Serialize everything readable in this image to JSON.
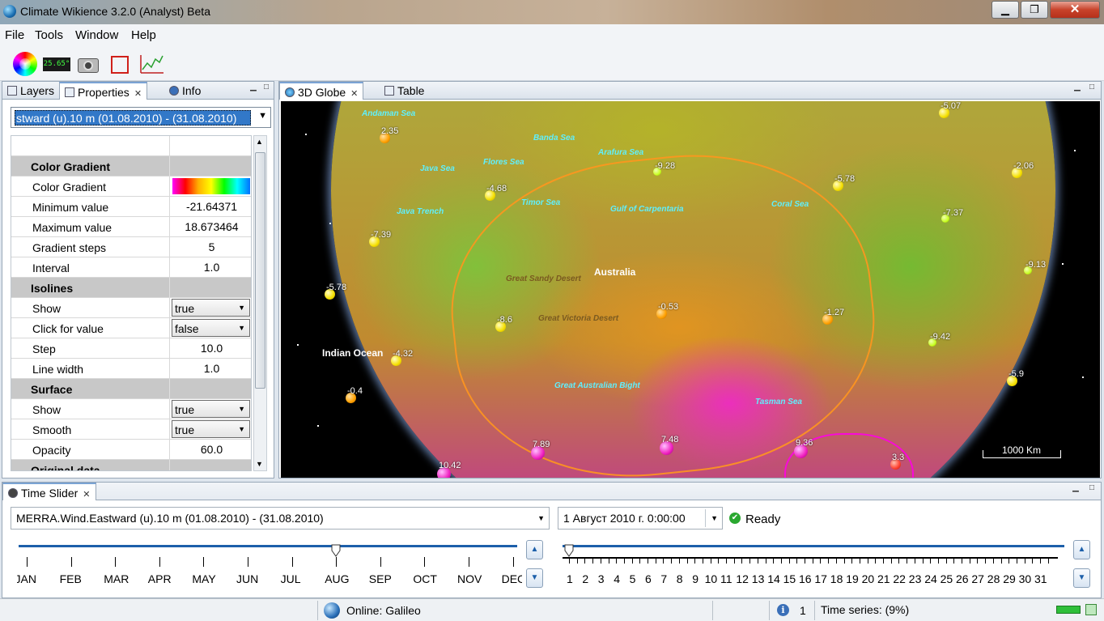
{
  "window": {
    "title": "Climate Wikience 3.2.0 (Analyst) Beta",
    "min": "▁",
    "max": "❐",
    "close": "✕"
  },
  "menu": [
    "File",
    "Tools",
    "Window",
    "Help"
  ],
  "toolbar": {
    "temp_display": "25.65°",
    "icons": [
      "color-palette-icon",
      "temperature-display-icon",
      "camera-icon",
      "region-select-icon",
      "chart-icon"
    ]
  },
  "left_panel": {
    "tabs": [
      {
        "label": "Layers"
      },
      {
        "label": "Properties",
        "close": "✕"
      },
      {
        "label": "Info"
      }
    ],
    "layer_select": "stward (u).10 m  (01.08.2010)  -  (31.08.2010)",
    "properties": [
      {
        "type": "cat",
        "name": "Color Gradient"
      },
      {
        "type": "grad",
        "name": "Color Gradient"
      },
      {
        "type": "val",
        "name": "Minimum value",
        "value": "-21.64371"
      },
      {
        "type": "val",
        "name": "Maximum value",
        "value": "18.673464"
      },
      {
        "type": "val",
        "name": "Gradient steps",
        "value": "5"
      },
      {
        "type": "val",
        "name": "Interval",
        "value": "1.0"
      },
      {
        "type": "cat",
        "name": "Isolines"
      },
      {
        "type": "combo",
        "name": "Show",
        "value": "true"
      },
      {
        "type": "combo",
        "name": "Click for value",
        "value": "false"
      },
      {
        "type": "val",
        "name": "Step",
        "value": "10.0"
      },
      {
        "type": "val",
        "name": "Line width",
        "value": "1.0"
      },
      {
        "type": "cat",
        "name": "Surface"
      },
      {
        "type": "combo",
        "name": "Show",
        "value": "true"
      },
      {
        "type": "combo",
        "name": "Smooth",
        "value": "true"
      },
      {
        "type": "val",
        "name": "Opacity",
        "value": "60.0"
      },
      {
        "type": "cat",
        "name": "Original data"
      }
    ]
  },
  "globe_panel": {
    "tabs": [
      {
        "label": "3D Globe",
        "close": "✕"
      },
      {
        "label": "Table"
      }
    ],
    "places": [
      {
        "name": "Andaman Sea",
        "style": ""
      },
      {
        "name": "Banda Sea",
        "style": ""
      },
      {
        "name": "Arafura Sea",
        "style": ""
      },
      {
        "name": "Java Sea",
        "style": ""
      },
      {
        "name": "Flores Sea",
        "style": ""
      },
      {
        "name": "Timor Sea",
        "style": ""
      },
      {
        "name": "Gulf of Carpentaria",
        "style": ""
      },
      {
        "name": "Coral Sea",
        "style": ""
      },
      {
        "name": "Java Trench",
        "style": ""
      },
      {
        "name": "Australia",
        "style": "white"
      },
      {
        "name": "Great Sandy Desert",
        "style": "dark"
      },
      {
        "name": "Great Victoria Desert",
        "style": "dark"
      },
      {
        "name": "Indian Ocean",
        "style": "white"
      },
      {
        "name": "Great Australian Bight",
        "style": ""
      },
      {
        "name": "Tasman Sea",
        "style": ""
      }
    ],
    "values": [
      {
        "text": "2.35",
        "kind": "o"
      },
      {
        "text": "-5.07",
        "kind": ""
      },
      {
        "text": "-9.28",
        "kind": "g"
      },
      {
        "text": "-5.78",
        "kind": ""
      },
      {
        "text": "-2.06",
        "kind": ""
      },
      {
        "text": "-4.68",
        "kind": ""
      },
      {
        "text": "-7.37",
        "kind": "g"
      },
      {
        "text": "-7.39",
        "kind": ""
      },
      {
        "text": "-9.13",
        "kind": "g"
      },
      {
        "text": "-5.78",
        "kind": ""
      },
      {
        "text": "-0.53",
        "kind": "o"
      },
      {
        "text": "-1.27",
        "kind": "o"
      },
      {
        "text": "-8.6",
        "kind": ""
      },
      {
        "text": "-9.42",
        "kind": "g"
      },
      {
        "text": "-4.32",
        "kind": ""
      },
      {
        "text": "-5.9",
        "kind": ""
      },
      {
        "text": "-0.4",
        "kind": "o"
      },
      {
        "text": "7.89",
        "kind": "m"
      },
      {
        "text": "7.48",
        "kind": "m"
      },
      {
        "text": "9.36",
        "kind": "m"
      },
      {
        "text": "3.3",
        "kind": "r"
      },
      {
        "text": "10.42",
        "kind": "m"
      }
    ],
    "scale_label": "1000 Km"
  },
  "time_panel": {
    "tab": "Time Slider",
    "close": "✕",
    "dataset": "MERRA.Wind.Eastward (u).10 m  (01.08.2010)  -  (31.08.2010)",
    "date": "1 Август 2010 г. 0:00:00",
    "status": "Ready",
    "months": [
      "JAN",
      "FEB",
      "MAR",
      "APR",
      "MAY",
      "JUN",
      "JUL",
      "AUG",
      "SEP",
      "OCT",
      "NOV",
      "DEC"
    ],
    "selected_month": "AUG",
    "days": [
      "1",
      "2",
      "3",
      "4",
      "5",
      "6",
      "7",
      "8",
      "9",
      "10",
      "11",
      "12",
      "13",
      "14",
      "15",
      "16",
      "17",
      "18",
      "19",
      "20",
      "21",
      "22",
      "23",
      "24",
      "25",
      "26",
      "27",
      "28",
      "29",
      "30",
      "31"
    ],
    "selected_day": "1"
  },
  "status_bar": {
    "online": "Online: Galileo",
    "info_count": "1",
    "time_series": "Time series: (9%)"
  }
}
